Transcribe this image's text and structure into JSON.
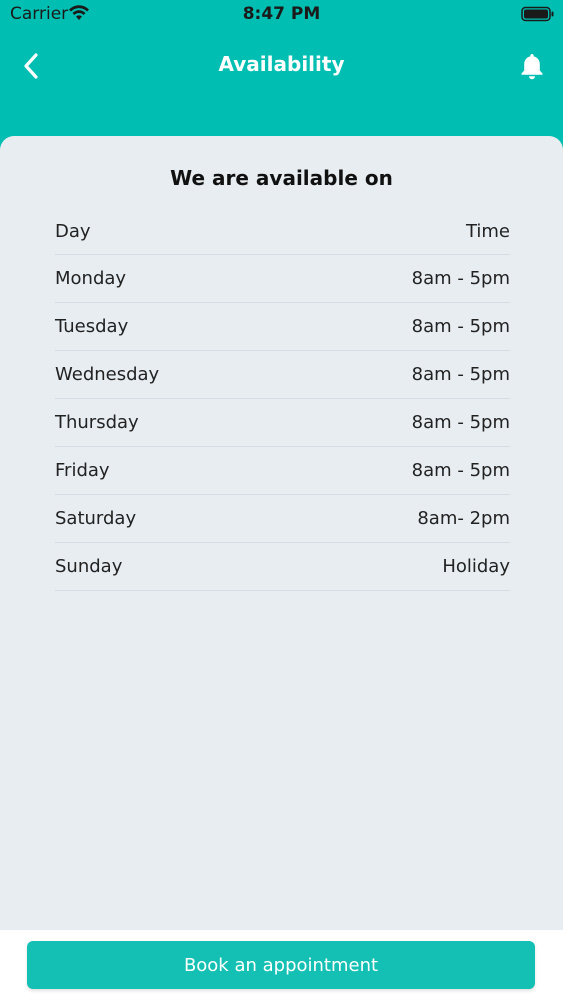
{
  "status_bar": {
    "carrier": "Carrier",
    "time": "8:47 PM",
    "icons": [
      "wifi-icon",
      "battery-icon"
    ]
  },
  "header": {
    "title": "Availability",
    "back_icon": "chevron-left-icon",
    "notification_icon": "bell-icon"
  },
  "availability": {
    "heading": "We are available on",
    "columns": {
      "day": "Day",
      "time": "Time"
    },
    "rows": [
      {
        "day": "Monday",
        "time": "8am - 5pm"
      },
      {
        "day": "Tuesday",
        "time": "8am - 5pm"
      },
      {
        "day": "Wednesday",
        "time": "8am - 5pm"
      },
      {
        "day": "Thursday",
        "time": "8am - 5pm"
      },
      {
        "day": "Friday",
        "time": "8am - 5pm"
      },
      {
        "day": "Saturday",
        "time": "8am- 2pm"
      },
      {
        "day": "Sunday",
        "time": "Holiday"
      }
    ]
  },
  "footer": {
    "book_label": "Book an appointment"
  },
  "colors": {
    "brand": "#00bfb2",
    "card_bg": "#e8edf1",
    "button": "#13c0b3"
  }
}
